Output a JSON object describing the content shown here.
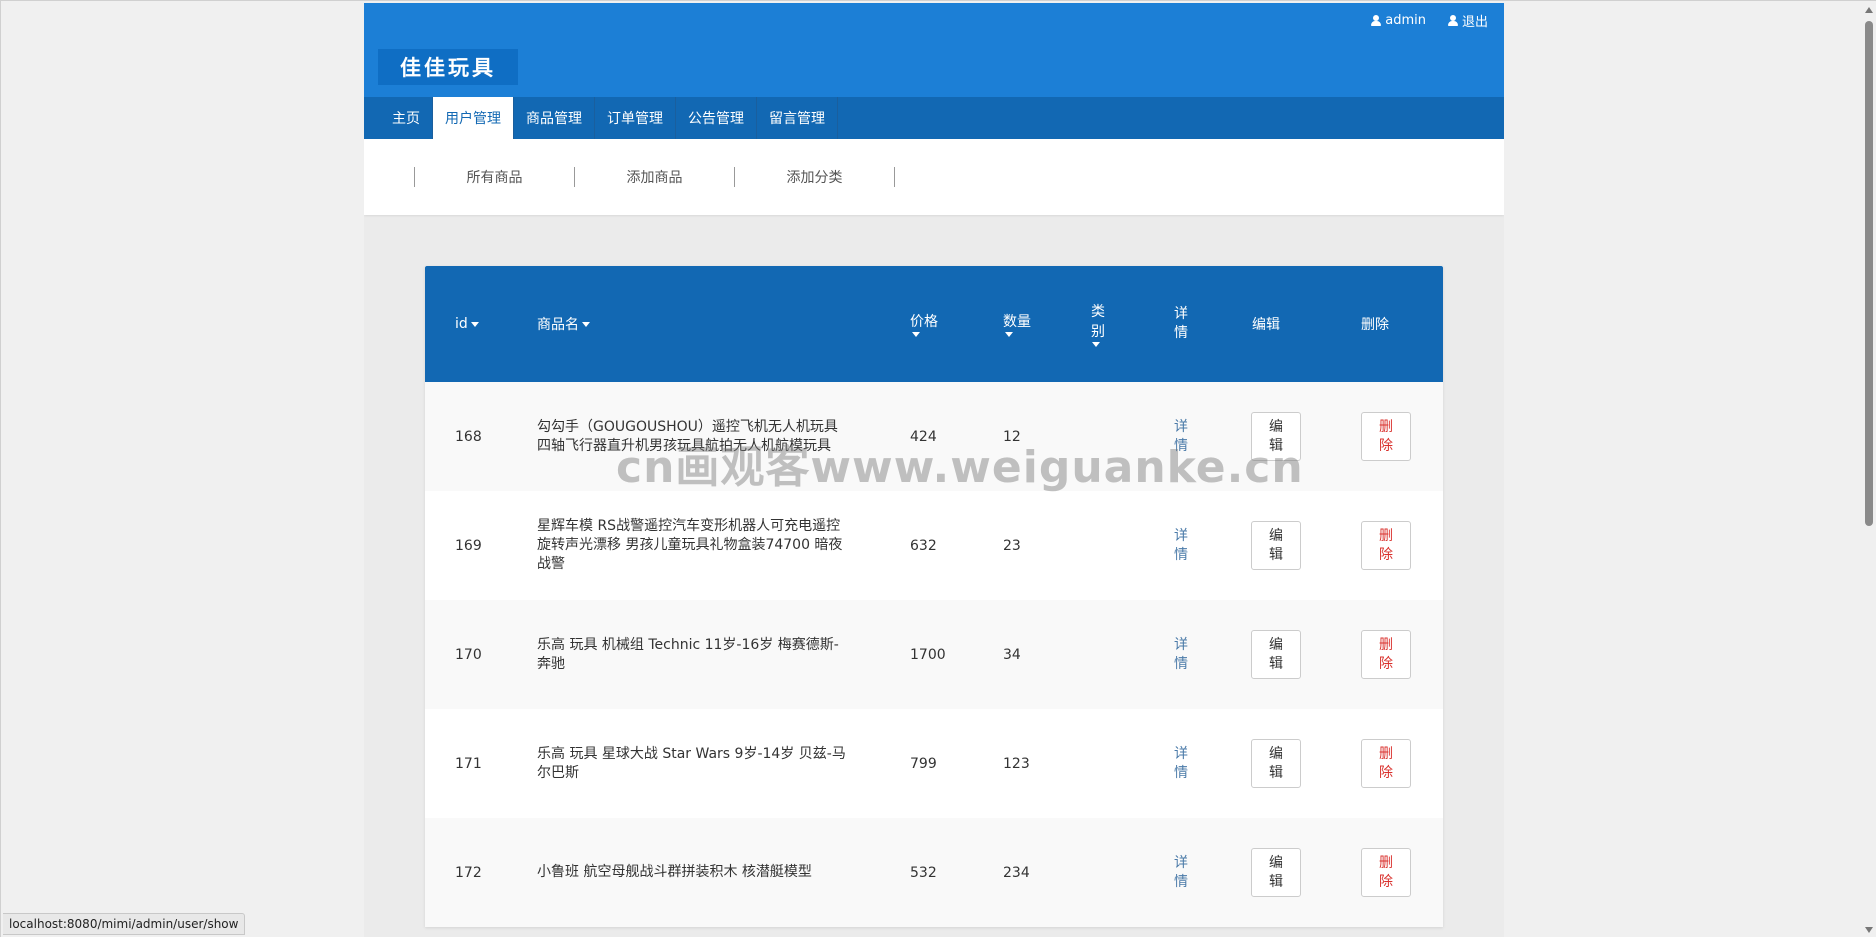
{
  "header": {
    "logo": "佳佳玩具",
    "user_link": "admin",
    "logout_link": "退出"
  },
  "nav": {
    "items": [
      "主页",
      "用户管理",
      "商品管理",
      "订单管理",
      "公告管理",
      "留言管理"
    ],
    "active_index": 1
  },
  "subnav": {
    "items": [
      "所有商品",
      "添加商品",
      "添加分类"
    ]
  },
  "table": {
    "headers": {
      "id": "id",
      "name": "商品名",
      "price": "价格",
      "qty": "数量",
      "category": "类别",
      "detail": "详情",
      "edit": "编辑",
      "delete": "删除"
    },
    "rows": [
      {
        "id": "168",
        "name": "勾勾手（GOUGOUSHOU）遥控飞机无人机玩具四轴飞行器直升机男孩玩具航拍无人机航模玩具",
        "price": "424",
        "qty": "12",
        "detail": "详情",
        "edit": "编辑",
        "delete": "删除"
      },
      {
        "id": "169",
        "name": "星辉车模 RS战警遥控汽车变形机器人可充电遥控旋转声光漂移 男孩儿童玩具礼物盒装74700 暗夜战警",
        "price": "632",
        "qty": "23",
        "detail": "详情",
        "edit": "编辑",
        "delete": "删除"
      },
      {
        "id": "170",
        "name": "乐高 玩具 机械组 Technic 11岁-16岁 梅赛德斯-奔驰",
        "price": "1700",
        "qty": "34",
        "detail": "详情",
        "edit": "编辑",
        "delete": "删除"
      },
      {
        "id": "171",
        "name": "乐高 玩具 星球大战 Star Wars 9岁-14岁 贝兹-马尔巴斯",
        "price": "799",
        "qty": "123",
        "detail": "详情",
        "edit": "编辑",
        "delete": "删除"
      },
      {
        "id": "172",
        "name": "小鲁班 航空母舰战斗群拼装积木 核潜艇模型",
        "price": "532",
        "qty": "234",
        "detail": "详情",
        "edit": "编辑",
        "delete": "删除"
      }
    ]
  },
  "watermark": "cn画观客www.weiguanke.cn",
  "statusbar": "localhost:8080/mimi/admin/user/show"
}
